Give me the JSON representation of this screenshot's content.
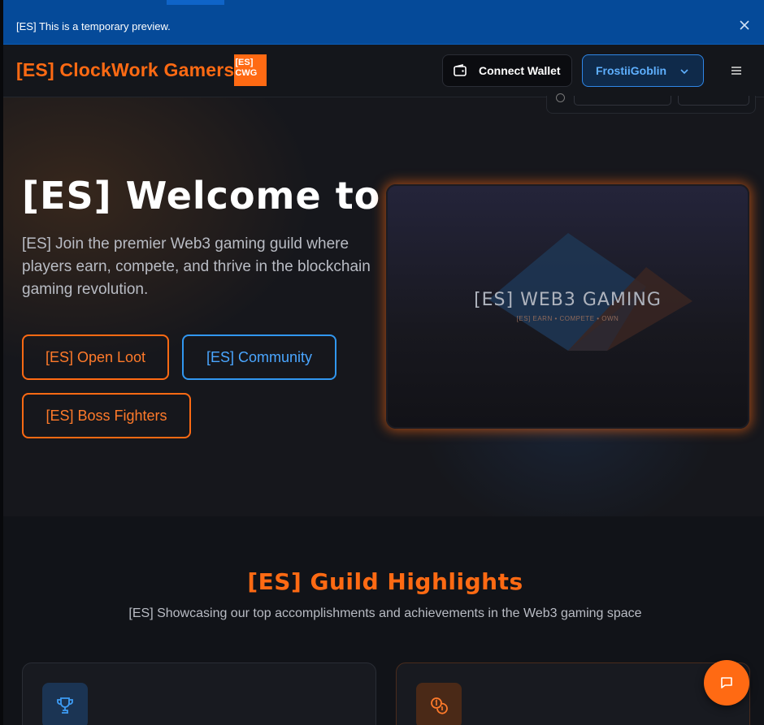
{
  "preview_banner": {
    "text": "[ES] This is a temporary preview.",
    "close_icon": "close-icon"
  },
  "header": {
    "brand_title": "[ES] ClockWork Gamers",
    "brand_badge_line1": "[ES]",
    "brand_badge_line2": "CWG",
    "connect_wallet_label": "Connect Wallet",
    "wallet_icon": "wallet-icon",
    "user_name": "FrostiiGoblin",
    "chevron_icon": "chevron-down-icon",
    "menu_icon": "hamburger-menu-icon"
  },
  "hero": {
    "title": "[ES] Welcome to",
    "subtitle": "[ES] Join the premier Web3 gaming guild where players earn, compete, and thrive in the blockchain gaming revolution.",
    "buttons": [
      {
        "label": "[ES] Open Loot"
      },
      {
        "label": "[ES] Community"
      },
      {
        "label": "[ES] Boss Fighters"
      }
    ],
    "card": {
      "title": "[ES] WEB3 GAMING",
      "tagline": "[ES] EARN • COMPETE • OWN"
    }
  },
  "highlights": {
    "title": "[ES] Guild Highlights",
    "subtitle": "[ES] Showcasing our top accomplishments and achievements in the Web3 gaming space",
    "cards": [
      {
        "icon": "trophy-icon"
      },
      {
        "icon": "coins-icon"
      }
    ]
  },
  "chat": {
    "icon": "chat-bubble-icon"
  },
  "colors": {
    "accent_orange": "#ff6a13",
    "accent_blue": "#3197f0",
    "banner_blue": "#054a99",
    "background": "#111318"
  }
}
